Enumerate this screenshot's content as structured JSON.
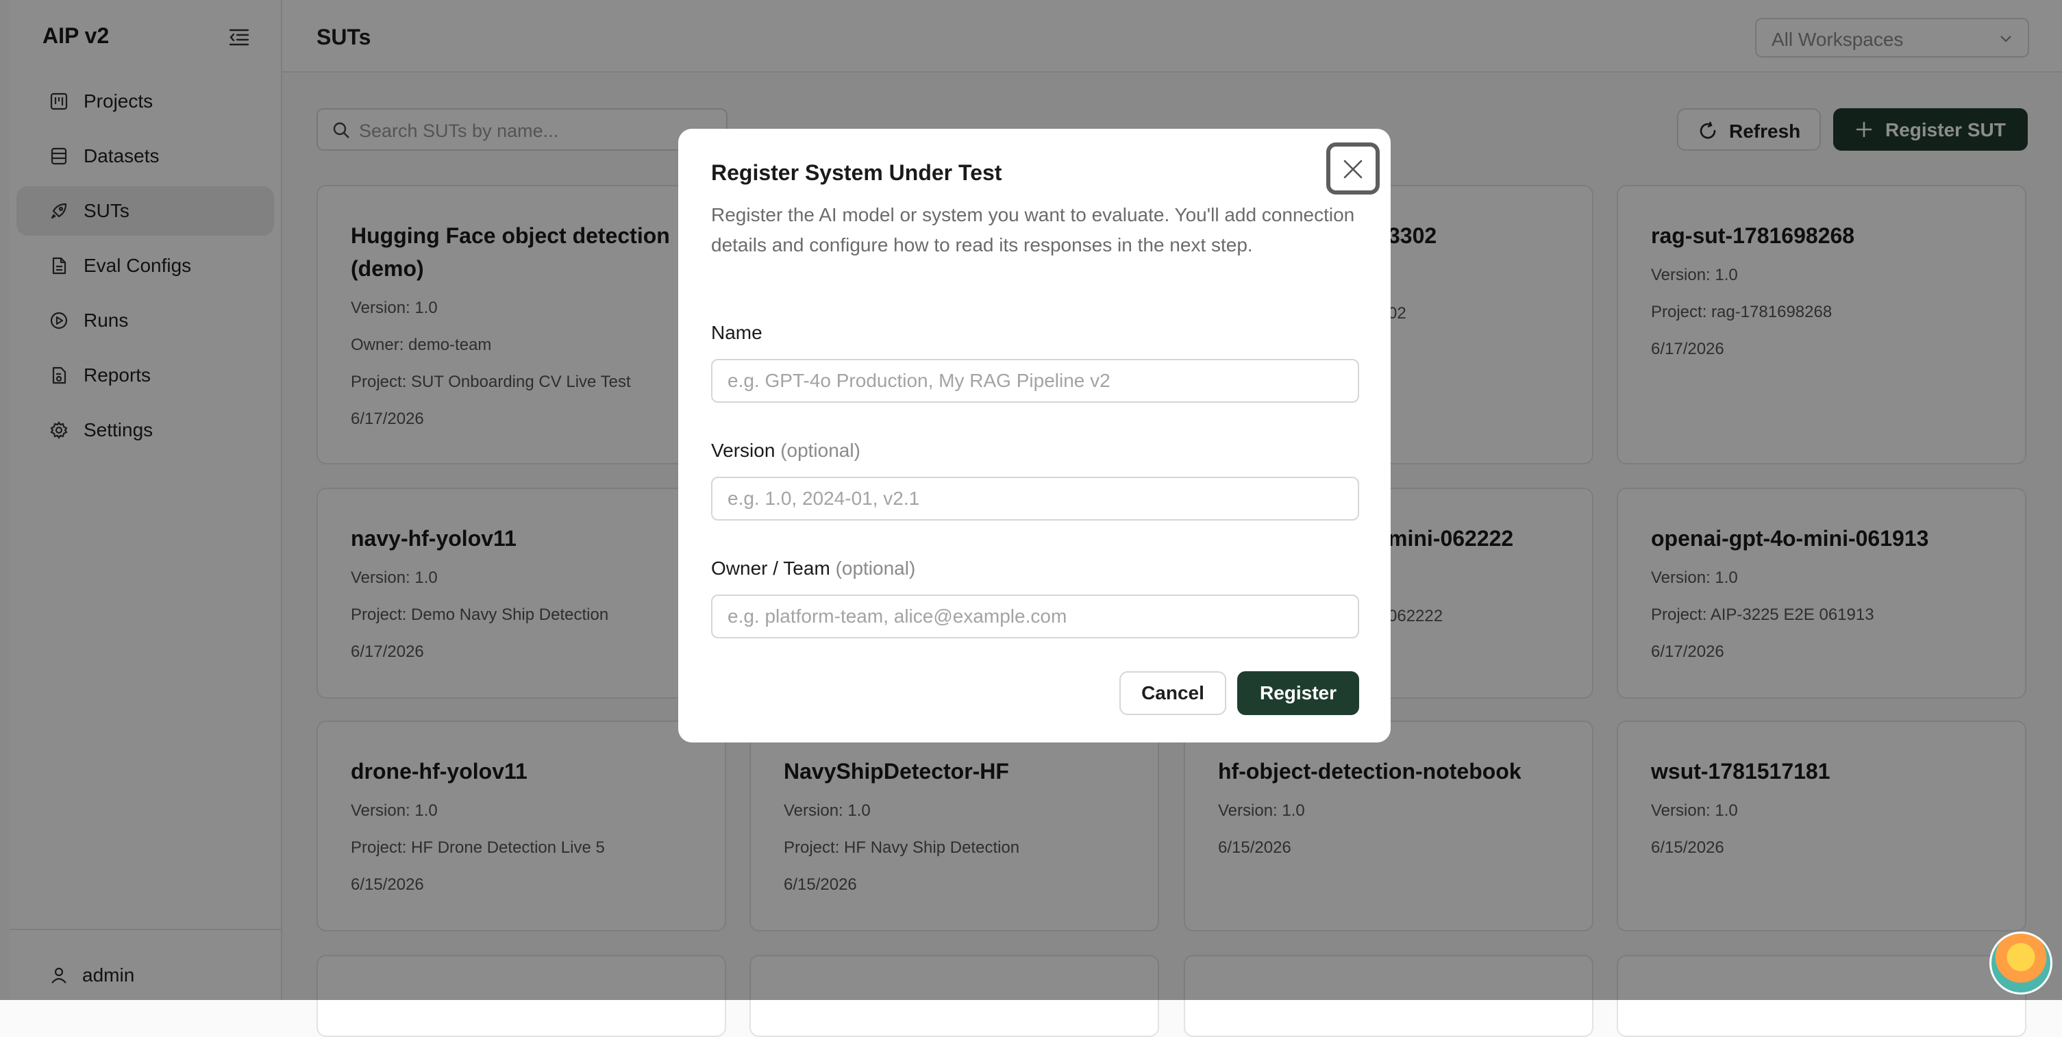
{
  "app": {
    "title": "AIP v2"
  },
  "sidebar": {
    "items": [
      {
        "label": "Projects",
        "icon": "kanban-icon"
      },
      {
        "label": "Datasets",
        "icon": "database-icon"
      },
      {
        "label": "SUTs",
        "icon": "rocket-icon",
        "active": true
      },
      {
        "label": "Eval Configs",
        "icon": "file-text-icon"
      },
      {
        "label": "Runs",
        "icon": "play-circle-icon"
      },
      {
        "label": "Reports",
        "icon": "report-icon"
      },
      {
        "label": "Settings",
        "icon": "gear-icon"
      }
    ],
    "user": "admin"
  },
  "header": {
    "title": "SUTs",
    "workspace_select": "All Workspaces"
  },
  "toolbar": {
    "search_placeholder": "Search SUTs by name...",
    "refresh_label": "Refresh",
    "register_label": "Register SUT"
  },
  "cards": [
    {
      "title": "Hugging Face object detection (demo)",
      "lines": [
        "Version: 1.0",
        "Owner: demo-team",
        "Project: SUT Onboarding CV Live Test",
        "6/17/2026"
      ]
    },
    {
      "title": "3302",
      "lines": [
        "02"
      ]
    },
    {
      "title": "rag-sut-1781698268",
      "lines": [
        "Version: 1.0",
        "Project: rag-1781698268",
        "6/17/2026"
      ]
    },
    {
      "title": "navy-hf-yolov11",
      "lines": [
        "Version: 1.0",
        "Project: Demo Navy Ship Detection",
        "6/17/2026"
      ]
    },
    {
      "title": "mini-062222",
      "lines": [
        "062222"
      ]
    },
    {
      "title": "openai-gpt-4o-mini-061913",
      "lines": [
        "Version: 1.0",
        "Project: AIP-3225 E2E 061913",
        "6/17/2026"
      ]
    },
    {
      "title": "drone-hf-yolov11",
      "lines": [
        "Version: 1.0",
        "Project: HF Drone Detection Live 5",
        "6/15/2026"
      ]
    },
    {
      "title": "NavyShipDetector-HF",
      "lines": [
        "Version: 1.0",
        "Project: HF Navy Ship Detection",
        "6/15/2026"
      ]
    },
    {
      "title": "hf-object-detection-notebook",
      "lines": [
        "Version: 1.0",
        "6/15/2026"
      ]
    },
    {
      "title": "wsut-1781517181",
      "lines": [
        "Version: 1.0",
        "6/15/2026"
      ]
    }
  ],
  "modal": {
    "title": "Register System Under Test",
    "description": "Register the AI model or system you want to evaluate. You'll add connection details and configure how to read its responses in the next step.",
    "fields": {
      "name": {
        "label": "Name",
        "placeholder": "e.g. GPT-4o Production, My RAG Pipeline v2"
      },
      "version": {
        "label": "Version",
        "optional": "(optional)",
        "placeholder": "e.g. 1.0, 2024-01, v2.1"
      },
      "owner": {
        "label": "Owner / Team",
        "optional": "(optional)",
        "placeholder": "e.g. platform-team, alice@example.com"
      }
    },
    "cancel_label": "Cancel",
    "register_label": "Register"
  },
  "colors": {
    "primary": "#1f3d2e",
    "overlay": "rgba(0,0,0,0.45)"
  }
}
